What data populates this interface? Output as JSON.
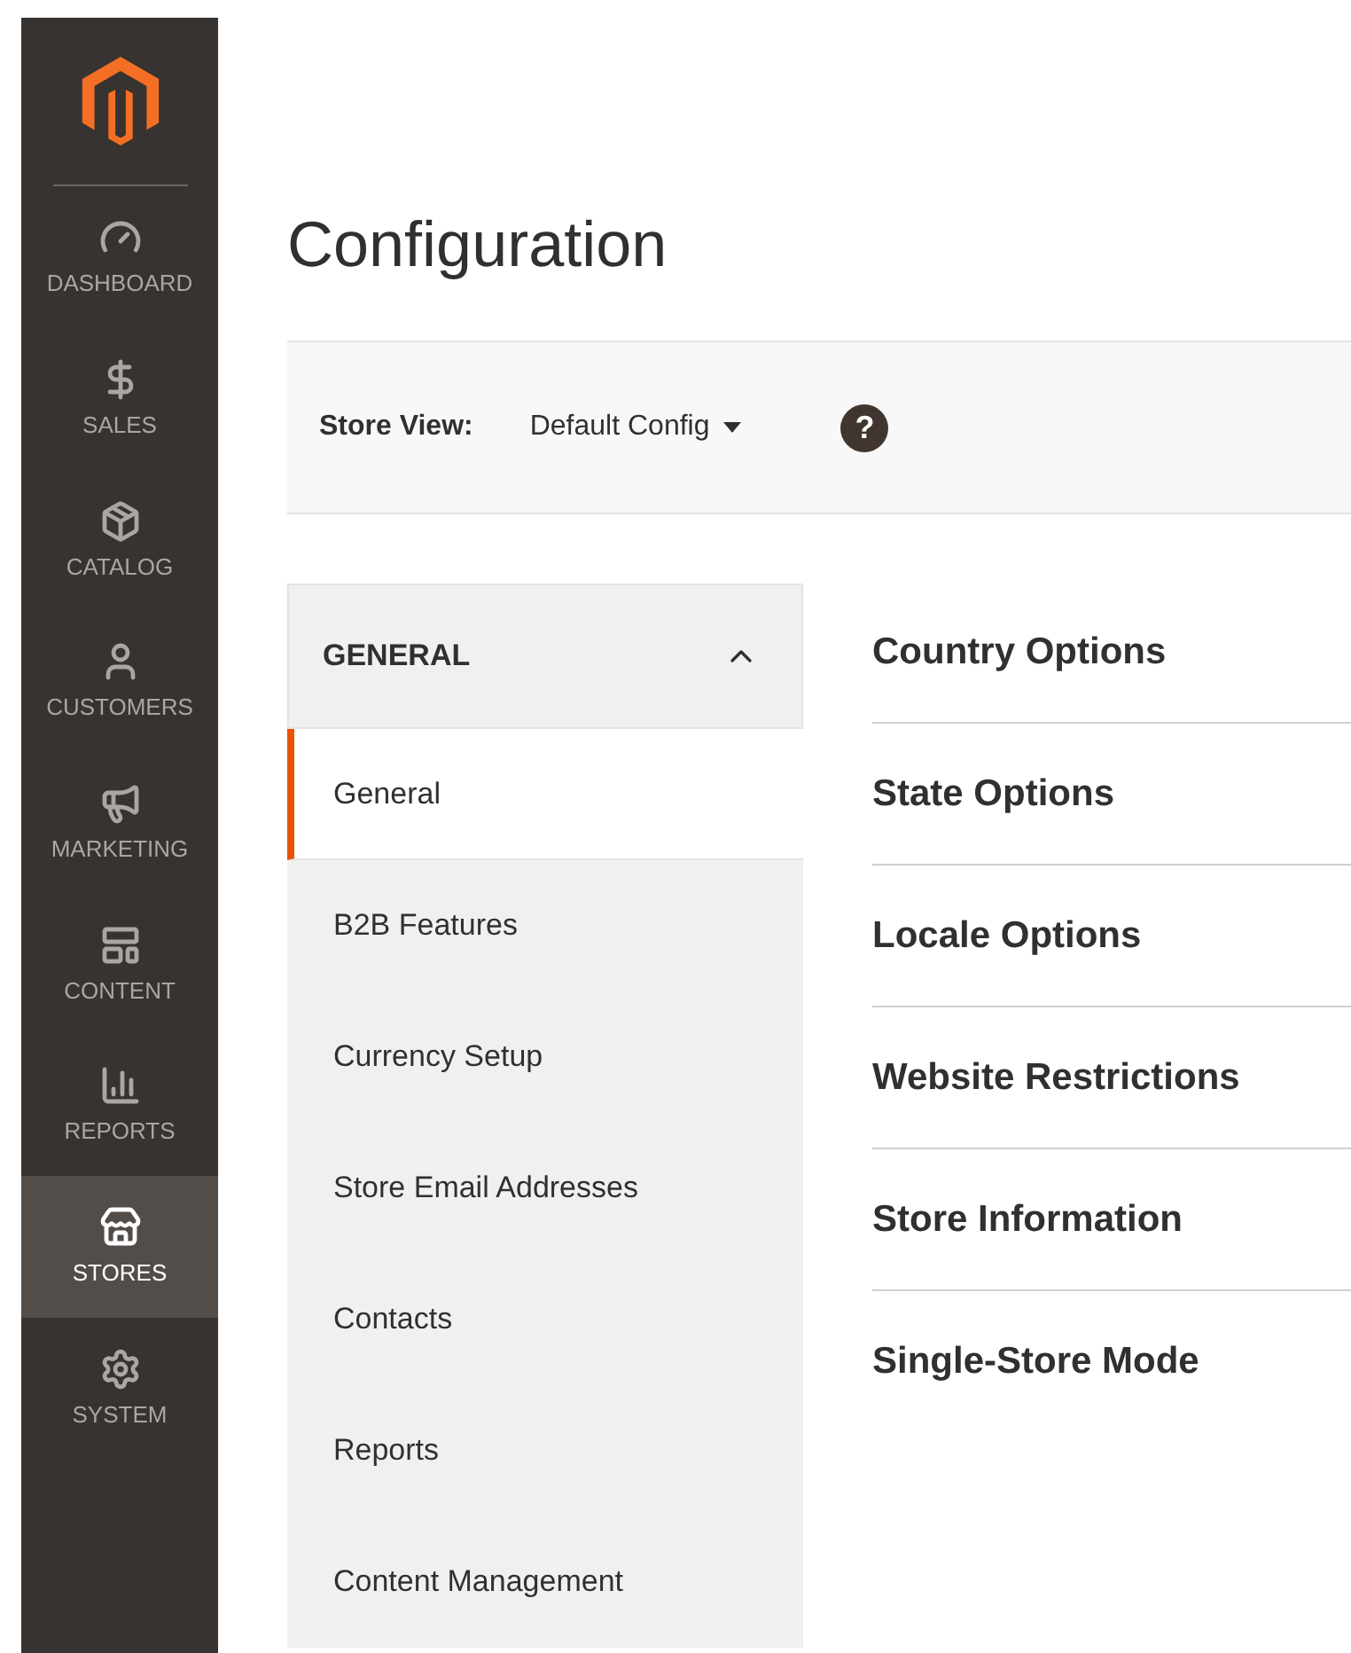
{
  "sidebar": {
    "items": [
      {
        "label": "DASHBOARD",
        "selected": false
      },
      {
        "label": "SALES",
        "selected": false
      },
      {
        "label": "CATALOG",
        "selected": false
      },
      {
        "label": "CUSTOMERS",
        "selected": false
      },
      {
        "label": "MARKETING",
        "selected": false
      },
      {
        "label": "CONTENT",
        "selected": false
      },
      {
        "label": "REPORTS",
        "selected": false
      },
      {
        "label": "STORES",
        "selected": true
      },
      {
        "label": "SYSTEM",
        "selected": false
      }
    ]
  },
  "page_title": "Configuration",
  "store_view": {
    "label": "Store View:",
    "value": "Default Config",
    "help": "?"
  },
  "section_nav": {
    "title": "GENERAL",
    "expanded": true,
    "items": [
      {
        "label": "General",
        "selected": true
      },
      {
        "label": "B2B Features",
        "selected": false
      },
      {
        "label": "Currency Setup",
        "selected": false
      },
      {
        "label": "Store Email Addresses",
        "selected": false
      },
      {
        "label": "Contacts",
        "selected": false
      },
      {
        "label": "Reports",
        "selected": false
      },
      {
        "label": "Content Management",
        "selected": false
      }
    ]
  },
  "groups": [
    "Country Options",
    "State Options",
    "Locale Options",
    "Website Restrictions",
    "Store Information",
    "Single-Store Mode"
  ]
}
